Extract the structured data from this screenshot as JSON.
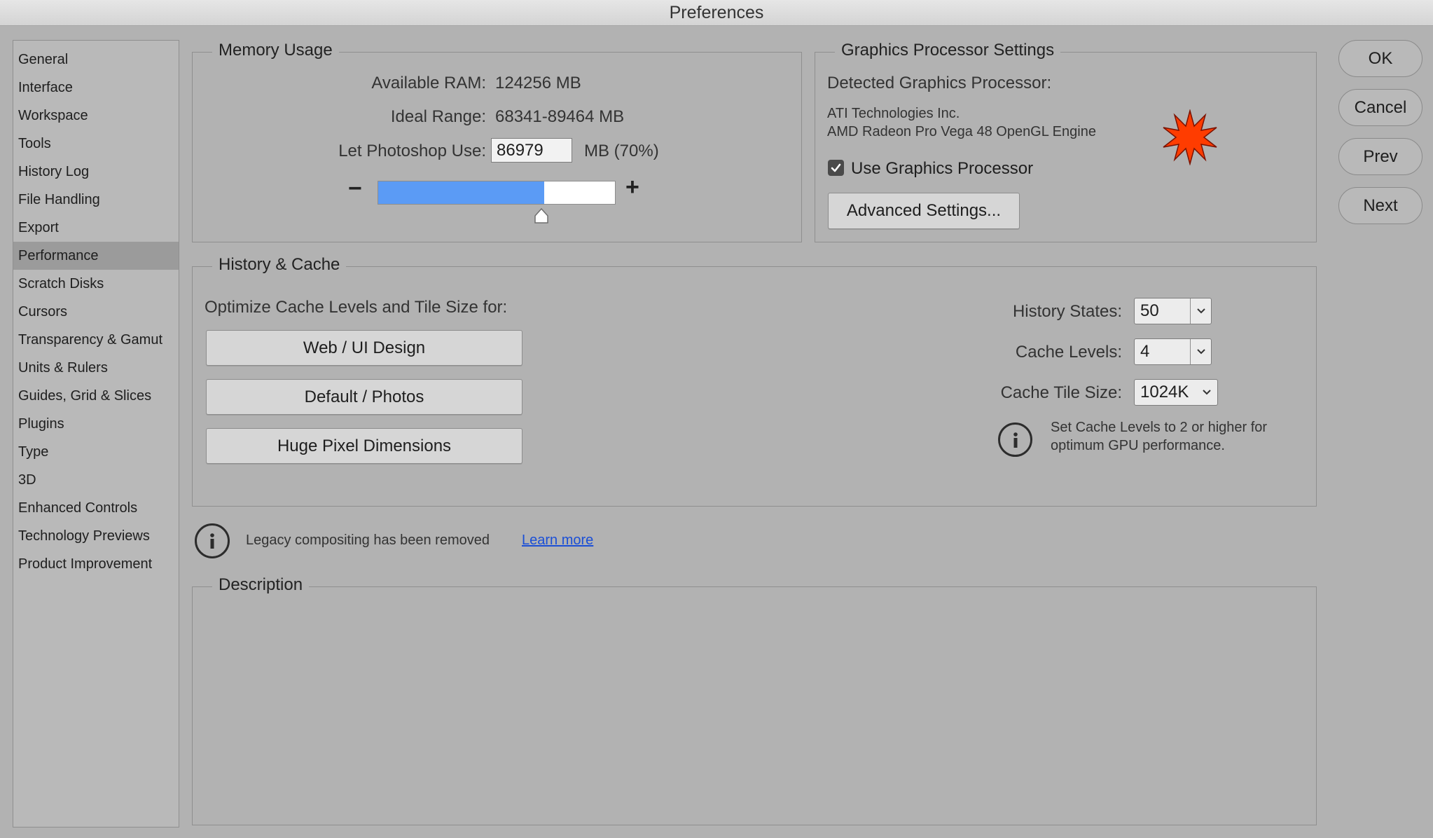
{
  "window": {
    "title": "Preferences"
  },
  "sidebar": {
    "items": [
      {
        "label": "General"
      },
      {
        "label": "Interface"
      },
      {
        "label": "Workspace"
      },
      {
        "label": "Tools"
      },
      {
        "label": "History Log"
      },
      {
        "label": "File Handling"
      },
      {
        "label": "Export"
      },
      {
        "label": "Performance",
        "active": true
      },
      {
        "label": "Scratch Disks"
      },
      {
        "label": "Cursors"
      },
      {
        "label": "Transparency & Gamut"
      },
      {
        "label": "Units & Rulers"
      },
      {
        "label": "Guides, Grid & Slices"
      },
      {
        "label": "Plugins"
      },
      {
        "label": "Type"
      },
      {
        "label": "3D"
      },
      {
        "label": "Enhanced Controls"
      },
      {
        "label": "Technology Previews"
      },
      {
        "label": "Product Improvement"
      }
    ]
  },
  "memory": {
    "title": "Memory Usage",
    "available_label": "Available RAM:",
    "available_value": "124256 MB",
    "ideal_label": "Ideal Range:",
    "ideal_value": "68341-89464 MB",
    "use_label": "Let Photoshop Use:",
    "use_value": "86979",
    "use_unit": "MB (70%)",
    "minus": "−",
    "plus": "+",
    "slider_percent": 70
  },
  "gpu": {
    "title": "Graphics Processor Settings",
    "detected_label": "Detected Graphics Processor:",
    "vendor": "ATI Technologies Inc.",
    "model": "AMD Radeon Pro Vega 48 OpenGL Engine",
    "use_gpu_label": "Use Graphics Processor",
    "use_gpu_checked": true,
    "advanced_label": "Advanced Settings..."
  },
  "history_cache": {
    "title": "History & Cache",
    "optimize_label": "Optimize Cache Levels and Tile Size for:",
    "presets": [
      "Web / UI Design",
      "Default / Photos",
      "Huge Pixel Dimensions"
    ],
    "history_states_label": "History States:",
    "history_states_value": "50",
    "cache_levels_label": "Cache Levels:",
    "cache_levels_value": "4",
    "tile_size_label": "Cache Tile Size:",
    "tile_size_value": "1024K",
    "hint_line1": "Set Cache Levels to 2 or higher for",
    "hint_line2": "optimum GPU performance."
  },
  "legacy": {
    "message": "Legacy compositing has been removed",
    "link": "Learn more"
  },
  "description": {
    "title": "Description"
  },
  "actions": {
    "ok": "OK",
    "cancel": "Cancel",
    "prev": "Prev",
    "next": "Next"
  },
  "colors": {
    "slider_fill": "#5b9bf5",
    "link": "#1b4fd6",
    "gpu_star": "#ff3c00"
  }
}
